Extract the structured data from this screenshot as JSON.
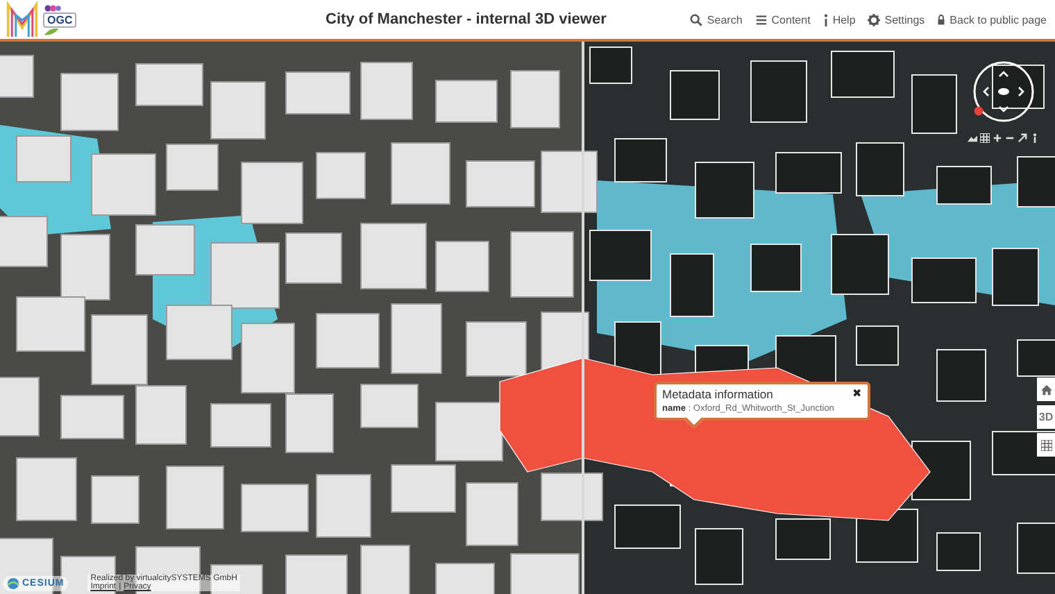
{
  "header": {
    "logo_text": "OGC",
    "title": "City of Manchester - internal 3D viewer",
    "nav": [
      {
        "label": "Search",
        "kind": "search"
      },
      {
        "label": "Content",
        "kind": "menu"
      },
      {
        "label": "Help",
        "kind": "help"
      },
      {
        "label": "Settings",
        "kind": "settings"
      },
      {
        "label": "Back to public page",
        "kind": "lock"
      }
    ]
  },
  "map": {
    "popup": {
      "title": "Metadata information",
      "key": "name",
      "separator": ":",
      "value": "Oxford_Rd_Whitworth_St_Junction",
      "close": "✖"
    },
    "view_buttons": [
      {
        "kind": "home"
      },
      {
        "kind": "text",
        "label": "3D"
      },
      {
        "kind": "grid"
      }
    ]
  },
  "footer": {
    "brand": "CESIUM",
    "credit": "Realized by virtualcitySYSTEMS GmbH",
    "links": [
      {
        "label": "Imprint"
      },
      {
        "label": "Privacy"
      }
    ],
    "separator": "|"
  }
}
